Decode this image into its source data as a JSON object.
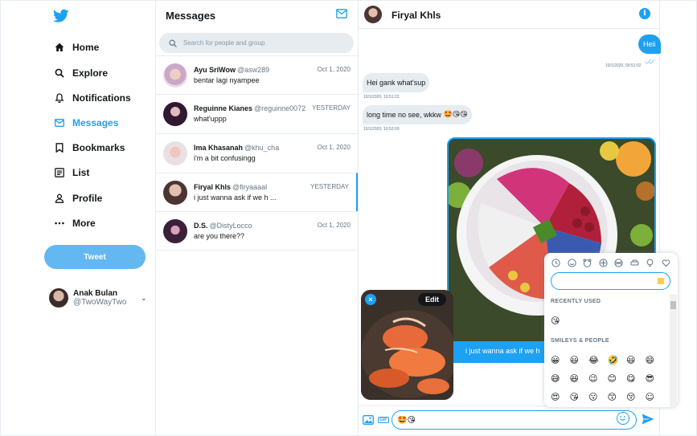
{
  "app": {
    "accent": "#1da1f2"
  },
  "sidebar": {
    "logo_icon": "twitter-bird-icon",
    "items": [
      {
        "label": "Home",
        "icon": "home-icon",
        "active": false
      },
      {
        "label": "Explore",
        "icon": "search-icon",
        "active": false
      },
      {
        "label": "Notifications",
        "icon": "bell-icon",
        "active": false
      },
      {
        "label": "Messages",
        "icon": "envelope-icon",
        "active": true
      },
      {
        "label": "Bookmarks",
        "icon": "bookmark-icon",
        "active": false
      },
      {
        "label": "List",
        "icon": "list-icon",
        "active": false
      },
      {
        "label": "Profile",
        "icon": "person-icon",
        "active": false
      },
      {
        "label": "More",
        "icon": "more-dots-icon",
        "active": false
      }
    ],
    "tweet_label": "Tweet",
    "account": {
      "name": "Anak Bulan",
      "handle": "@TwoWayTwo"
    }
  },
  "messages": {
    "title": "Messages",
    "search_placeholder": "Search for people and group",
    "conversations": [
      {
        "name": "Ayu SriWow",
        "handle": "@asw289",
        "date": "Oct 1, 2020",
        "preview": "bentar lagi nyampee"
      },
      {
        "name": "Reguinne Kianes",
        "handle": "@reguinne0072",
        "date": "YESTERDAY",
        "preview": "what'uppp"
      },
      {
        "name": "Ima Khasanah",
        "handle": "@khu_cha",
        "date": "Oct 1, 2020",
        "preview": "i'm a bit confusingg"
      },
      {
        "name": "Firyal Khls",
        "handle": "@firyaaaal",
        "date": "YESTERDAY",
        "preview": "i just wanna ask if we h ..."
      },
      {
        "name": "D.S.",
        "handle": "@DistyLocco",
        "date": "Oct 1, 2020",
        "preview": "are you there??"
      }
    ]
  },
  "chat": {
    "title": "Firyal Khls",
    "out_message": "Heii",
    "out_time": "10/1/2020, 09:51:02",
    "in_messages": [
      {
        "text": "Hei gank what'sup",
        "time": "10/1/2020, 10:51:22"
      },
      {
        "text": "long time no see, wkkw",
        "emoji": "🤩😘😘",
        "time": "10/1/2020, 10:52:00"
      }
    ],
    "photo_caption": "i just wanna ask if we h",
    "attachment_edit_label": "Edit",
    "attachment_close": "×",
    "compose_value": "🤩😘",
    "gif_label": "GIF"
  },
  "emoji_picker": {
    "recently_used_label": "RECENTLY USED",
    "recent": [
      "😘"
    ],
    "smileys_label": "SMILEYS & PEOPLE",
    "rows": [
      [
        "😀",
        "😃",
        "😂",
        "🤣",
        "😃",
        "😄"
      ],
      [
        "😅",
        "😆",
        "😉",
        "😊",
        "😋",
        "😎"
      ],
      [
        "😍",
        "😘",
        "😗",
        "😙",
        "😚",
        "☺"
      ]
    ]
  }
}
